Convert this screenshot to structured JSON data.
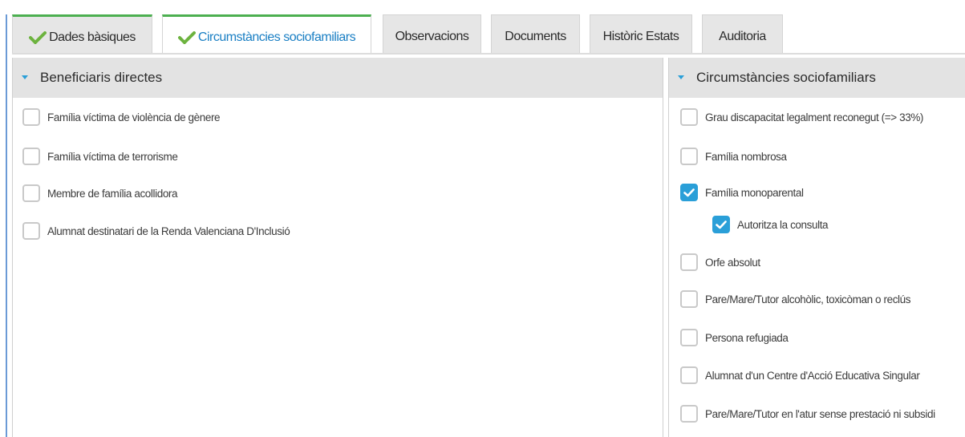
{
  "tabs": [
    {
      "label": "Dades bàsiques",
      "checked": true
    },
    {
      "label": "Circumstàncies sociofamiliars",
      "checked": true
    },
    {
      "label": "Observacions"
    },
    {
      "label": "Documents"
    },
    {
      "label": "Històric Estats"
    },
    {
      "label": "Auditoria"
    }
  ],
  "left_panel": {
    "title": "Beneficiaris directes",
    "items": [
      {
        "label": "Família víctima de violència de gènere",
        "checked": false
      },
      {
        "label": "Família víctima de terrorisme",
        "checked": false
      },
      {
        "label": "Membre de família acollidora",
        "checked": false
      },
      {
        "label": "Alumnat destinatari de la Renda Valenciana D'Inclusió",
        "checked": false
      }
    ]
  },
  "right_panel": {
    "title": "Circumstàncies sociofamiliars",
    "items": [
      {
        "label": "Grau discapacitat legalment reconegut (=> 33%)",
        "checked": false
      },
      {
        "label": "Família nombrosa",
        "checked": false
      },
      {
        "label": "Família monoparental",
        "checked": true
      },
      {
        "label": "Autoritza la consulta",
        "checked": true
      },
      {
        "label": "Orfe absolut",
        "checked": false
      },
      {
        "label": "Pare/Mare/Tutor alcohòlic, toxicòman o reclús",
        "checked": false
      },
      {
        "label": "Persona refugiada",
        "checked": false
      },
      {
        "label": "Alumnat d'un Centre d'Acció Educativa Singular",
        "checked": false
      },
      {
        "label": "Pare/Mare/Tutor en l'atur sense prestació ni subsidi",
        "checked": false
      }
    ]
  },
  "colors": {
    "accent": "#2a9fd8",
    "tab_ok": "#4caf50",
    "active_tab_text": "#1a7fc4"
  }
}
